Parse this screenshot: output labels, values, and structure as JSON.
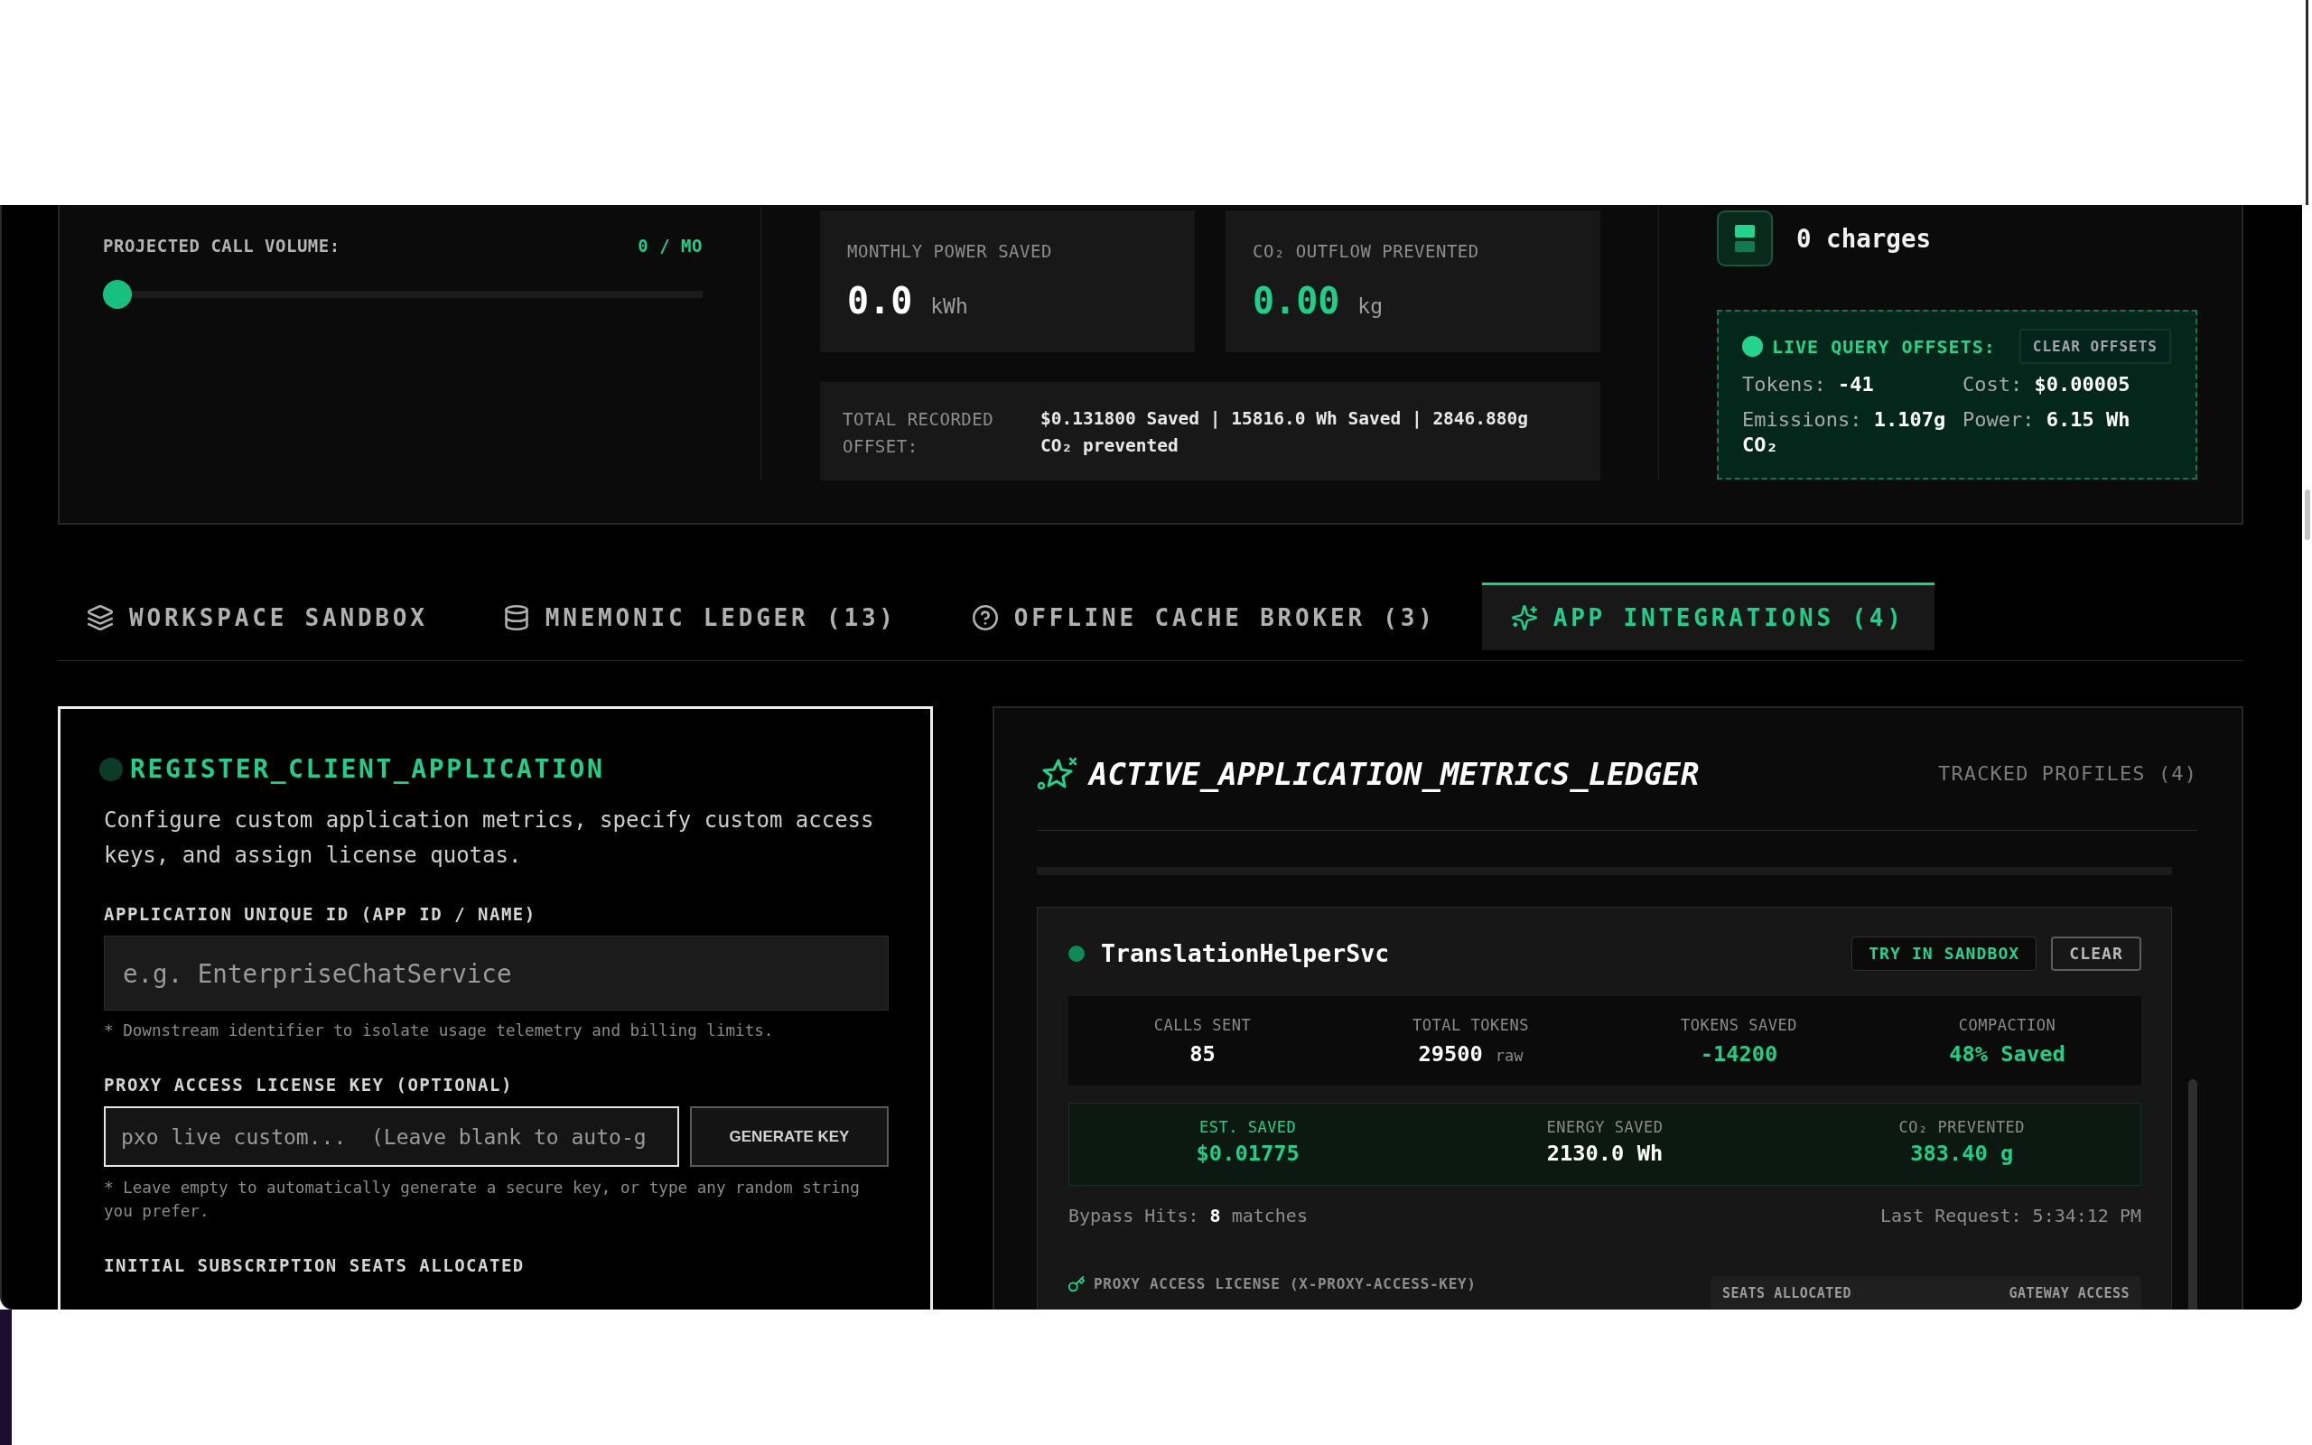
{
  "top_panel": {
    "call_volume": {
      "label": "PROJECTED CALL VOLUME:",
      "reading": "0 / MO",
      "level": 0
    },
    "stats": [
      {
        "kind": "plain",
        "label": "MONTHLY POWER SAVED",
        "value": "0.0",
        "unit": "kWh"
      },
      {
        "kind": "accent",
        "label": "CO₂ OUTFLOW PREVENTED",
        "value": "0.00",
        "unit": "kg"
      }
    ],
    "total": {
      "label": "TOTAL RECORDED OFFSET:",
      "value": "$0.131800 Saved | 15816.0 Wh Saved | 2846.880g CO₂ prevented"
    },
    "charges": "0 charges",
    "live_offsets": {
      "title": "LIVE QUERY OFFSETS:",
      "button": "CLEAR OFFSETS",
      "items": [
        "Tokens: **-41**",
        "Cost: **$0.00005**",
        "Emissions: **1.107g CO₂**",
        "Power: **6.15 Wh**"
      ]
    }
  },
  "tabs": [
    {
      "label": "WORKSPACE SANDBOX",
      "selected": false
    },
    {
      "label": "MNEMONIC LEDGER (13)",
      "selected": false
    },
    {
      "label": "OFFLINE CACHE BROKER (3)",
      "selected": false
    },
    {
      "label": "APP INTEGRATIONS (4)",
      "selected": true
    }
  ],
  "register_panel": {
    "focused": true,
    "title": "REGISTER_CLIENT_APPLICATION",
    "description": "Configure custom application metrics, specify custom access keys, and assign license quotas.",
    "fields": [
      {
        "label": "APPLICATION UNIQUE ID (APP ID / NAME)",
        "placeholder": "e.g. EnterpriseChatService",
        "focused": false,
        "hint": "* Downstream identifier to isolate usage telemetry and billing limits."
      },
      {
        "label": "PROXY ACCESS LICENSE KEY (OPTIONAL)",
        "placeholder": "pxo_live_custom...  (Leave blank to auto-g",
        "focused": true,
        "button": "GENERATE KEY",
        "hint": "* Leave empty to automatically generate a secure key, or type any random string you prefer."
      }
    ],
    "seats_label": "INITIAL SUBSCRIPTION SEATS ALLOCATED"
  },
  "ledger": {
    "title": "ACTIVE_APPLICATION_METRICS_LEDGER",
    "count": "TRACKED PROFILES (4)",
    "apps": [
      {
        "name": "TranslationHelperSvc",
        "active": true,
        "buttons": [
          {
            "kind": "primary",
            "label": "TRY IN SANDBOX"
          },
          {
            "kind": "secondary",
            "label": "CLEAR"
          }
        ],
        "usage": [
          {
            "kind": "plain",
            "label": "CALLS SENT",
            "value": "85"
          },
          {
            "kind": "plain",
            "label": "TOTAL TOKENS",
            "value": "29500",
            "unit": "raw"
          },
          {
            "kind": "positive",
            "label": "TOKENS SAVED",
            "value": "-14200"
          },
          {
            "kind": "positive",
            "label": "COMPACTION",
            "value": "48% Saved"
          }
        ],
        "savings": [
          {
            "kind": "highlight",
            "label": "EST. SAVED",
            "value": "$0.01775"
          },
          {
            "kind": "plain",
            "label": "ENERGY SAVED",
            "value": "2130.0 Wh"
          },
          {
            "kind": "positive",
            "label": "CO₂ PREVENTED",
            "value": "383.40 g"
          }
        ],
        "bypass": "Bypass Hits: **8** matches",
        "last_request": "Last Request: 5:34:12 PM",
        "license_label": "PROXY ACCESS LICENSE (X-PROXY-ACCESS-KEY)",
        "seats_columns": [
          "SEATS ALLOCATED",
          "GATEWAY ACCESS"
        ]
      }
    ]
  }
}
